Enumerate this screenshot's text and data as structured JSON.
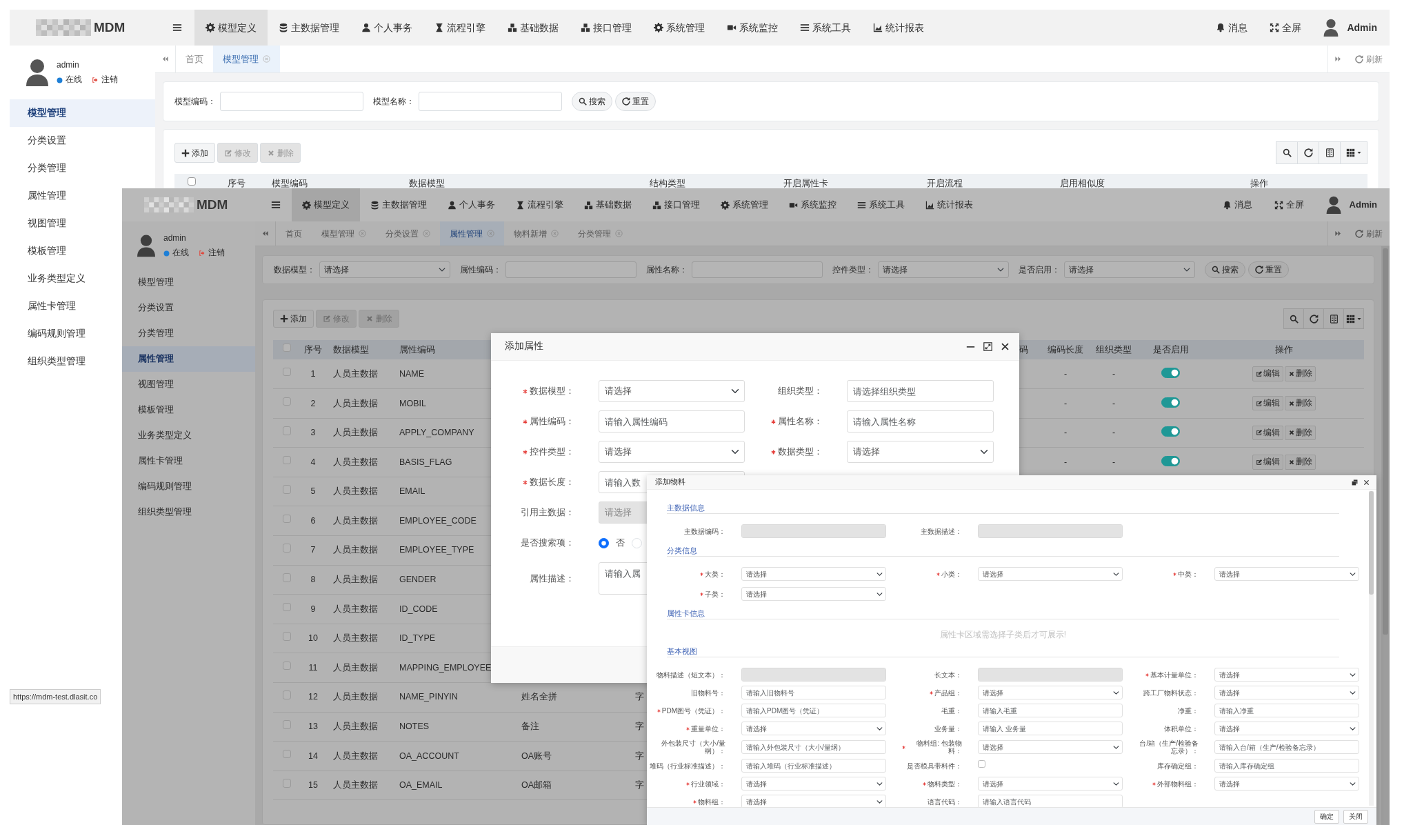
{
  "windows": [
    {
      "logo": "MDM",
      "menu": [
        {
          "label": "模型定义",
          "selected": true
        },
        {
          "label": "主数据管理",
          "selected": false
        },
        {
          "label": "个人事务",
          "selected": false
        },
        {
          "label": "流程引擎",
          "selected": false
        },
        {
          "label": "基础数据",
          "selected": false
        },
        {
          "label": "接口管理",
          "selected": false
        },
        {
          "label": "系统管理",
          "selected": false
        },
        {
          "label": "系统监控",
          "selected": false
        },
        {
          "label": "系统工具",
          "selected": false
        },
        {
          "label": "统计报表",
          "selected": false
        }
      ],
      "header_right": {
        "messages": "消息",
        "fullscreen": "全屏",
        "user": "Admin"
      },
      "sidebar": {
        "user": "admin",
        "status": "在线",
        "logout": "注销",
        "items": [
          {
            "label": "模型管理",
            "selected": true
          },
          {
            "label": "分类设置",
            "selected": false
          },
          {
            "label": "分类管理",
            "selected": false
          },
          {
            "label": "属性管理",
            "selected": false
          },
          {
            "label": "视图管理",
            "selected": false
          },
          {
            "label": "模板管理",
            "selected": false
          },
          {
            "label": "业务类型定义",
            "selected": false
          },
          {
            "label": "属性卡管理",
            "selected": false
          },
          {
            "label": "编码规则管理",
            "selected": false
          },
          {
            "label": "组织类型管理",
            "selected": false
          }
        ]
      },
      "tabs": [
        {
          "label": "首页",
          "selected": false,
          "closable": false
        },
        {
          "label": "模型管理",
          "selected": true,
          "closable": true
        }
      ],
      "refresh": "刷新",
      "search": {
        "fields": [
          {
            "kind": "input",
            "label": "模型编码："
          },
          {
            "kind": "input",
            "label": "模型名称："
          }
        ],
        "buttons": [
          "搜索",
          "重置"
        ]
      },
      "toolbar": [
        {
          "label": "添加",
          "disabled": false
        },
        {
          "label": "修改",
          "disabled": true
        },
        {
          "label": "删除",
          "disabled": true
        }
      ],
      "table": {
        "select_all_checked": false,
        "columns": [
          "序号",
          "模型编码",
          "数据模型",
          "结构类型",
          "开启属性卡",
          "开启流程",
          "启用相似度",
          "操作"
        ]
      },
      "status_url": "https://mdm-test.dlasit.co"
    },
    {
      "logo": "MDM",
      "menu": [
        {
          "label": "模型定义",
          "selected": true
        },
        {
          "label": "主数据管理",
          "selected": false
        },
        {
          "label": "个人事务",
          "selected": false
        },
        {
          "label": "流程引擎",
          "selected": false
        },
        {
          "label": "基础数据",
          "selected": false
        },
        {
          "label": "接口管理",
          "selected": false
        },
        {
          "label": "系统管理",
          "selected": false
        },
        {
          "label": "系统监控",
          "selected": false
        },
        {
          "label": "系统工具",
          "selected": false
        },
        {
          "label": "统计报表",
          "selected": false
        }
      ],
      "header_right": {
        "messages": "消息",
        "fullscreen": "全屏",
        "user": "Admin"
      },
      "sidebar": {
        "user": "admin",
        "status": "在线",
        "logout": "注销",
        "items": [
          {
            "label": "模型管理",
            "selected": false
          },
          {
            "label": "分类设置",
            "selected": false
          },
          {
            "label": "分类管理",
            "selected": false
          },
          {
            "label": "属性管理",
            "selected": true
          },
          {
            "label": "视图管理",
            "selected": false
          },
          {
            "label": "模板管理",
            "selected": false
          },
          {
            "label": "业务类型定义",
            "selected": false
          },
          {
            "label": "属性卡管理",
            "selected": false
          },
          {
            "label": "编码规则管理",
            "selected": false
          },
          {
            "label": "组织类型管理",
            "selected": false
          }
        ]
      },
      "tabs": [
        {
          "label": "首页",
          "selected": false,
          "closable": false
        },
        {
          "label": "模型管理",
          "selected": false,
          "closable": true
        },
        {
          "label": "分类设置",
          "selected": false,
          "closable": true
        },
        {
          "label": "属性管理",
          "selected": true,
          "closable": true
        },
        {
          "label": "物料新增",
          "selected": false,
          "closable": true
        },
        {
          "label": "分类管理",
          "selected": false,
          "closable": true
        }
      ],
      "refresh": "刷新",
      "search": {
        "fields": [
          {
            "kind": "select",
            "label": "数据模型：",
            "value": "请选择"
          },
          {
            "kind": "input",
            "label": "属性编码："
          },
          {
            "kind": "input",
            "label": "属性名称："
          },
          {
            "kind": "select",
            "label": "控件类型：",
            "value": "请选择"
          },
          {
            "kind": "select",
            "label": "是否启用：",
            "value": "请选择"
          }
        ],
        "buttons": [
          "搜索",
          "重置"
        ]
      },
      "toolbar": [
        {
          "label": "添加",
          "disabled": false
        },
        {
          "label": "修改",
          "disabled": true
        },
        {
          "label": "删除",
          "disabled": true
        }
      ],
      "table": {
        "select_all_checked": false,
        "columns": [
          "序号",
          "数据模型",
          "属性编码",
          "码",
          "编码长度",
          "组织类型",
          "是否启用",
          "操作"
        ],
        "rows": [
          {
            "checked": false,
            "no": "1",
            "model": "人员主数据",
            "code": "NAME",
            "code_length": "-",
            "org_type": "-",
            "enabled": true,
            "actions": [
              "编辑",
              "删除"
            ]
          },
          {
            "checked": false,
            "no": "2",
            "model": "人员主数据",
            "code": "MOBIL",
            "code_length": "-",
            "org_type": "-",
            "enabled": true,
            "actions": [
              "编辑",
              "删除"
            ]
          },
          {
            "checked": false,
            "no": "3",
            "model": "人员主数据",
            "code": "APPLY_COMPANY",
            "code_length": "-",
            "org_type": "-",
            "enabled": true,
            "actions": [
              "编辑",
              "删除"
            ]
          },
          {
            "checked": false,
            "no": "4",
            "model": "人员主数据",
            "code": "BASIS_FLAG",
            "code_length": "-",
            "org_type": "-",
            "enabled": true,
            "actions": [
              "编辑",
              "删除"
            ]
          },
          {
            "checked": false,
            "no": "5",
            "model": "人员主数据",
            "code": "EMAIL"
          },
          {
            "checked": false,
            "no": "6",
            "model": "人员主数据",
            "code": "EMPLOYEE_CODE"
          },
          {
            "checked": false,
            "no": "7",
            "model": "人员主数据",
            "code": "EMPLOYEE_TYPE"
          },
          {
            "checked": false,
            "no": "8",
            "model": "人员主数据",
            "code": "GENDER"
          },
          {
            "checked": false,
            "no": "9",
            "model": "人员主数据",
            "code": "ID_CODE"
          },
          {
            "checked": false,
            "no": "10",
            "model": "人员主数据",
            "code": "ID_TYPE"
          },
          {
            "checked": false,
            "no": "11",
            "model": "人员主数据",
            "code": "MAPPING_EMPLOYEE"
          },
          {
            "checked": false,
            "no": "12",
            "model": "人员主数据",
            "code": "NAME_PINYIN",
            "column_5": "姓名全拼",
            "column_6": "字"
          },
          {
            "checked": false,
            "no": "13",
            "model": "人员主数据",
            "code": "NOTES",
            "column_5": "备注",
            "column_6": "字"
          },
          {
            "checked": false,
            "no": "14",
            "model": "人员主数据",
            "code": "OA_ACCOUNT",
            "column_5": "OA账号",
            "column_6": "字"
          },
          {
            "checked": false,
            "no": "15",
            "model": "人员主数据",
            "code": "OA_EMAIL",
            "column_5": "OA邮箱",
            "column_6": "字"
          }
        ]
      }
    }
  ],
  "dialogs": [
    {
      "title": "添加属性",
      "rows": [
        {
          "left": {
            "kind": "select",
            "label": "数据模型：",
            "required": true,
            "disabled": false,
            "value": "请选择"
          },
          "right": {
            "kind": "input",
            "label": "组织类型：",
            "required": false,
            "disabled": false,
            "placeholder": "请选择组织类型"
          }
        },
        {
          "left": {
            "kind": "input",
            "label": "属性编码：",
            "required": true,
            "disabled": false,
            "placeholder": "请输入属性编码"
          },
          "right": {
            "kind": "input",
            "label": "属性名称：",
            "required": true,
            "disabled": false,
            "placeholder": "请输入属性名称"
          }
        },
        {
          "left": {
            "kind": "select",
            "label": "控件类型：",
            "required": true,
            "disabled": false,
            "value": "请选择"
          },
          "right": {
            "kind": "select",
            "label": "数据类型：",
            "required": true,
            "disabled": false,
            "value": "请选择"
          }
        },
        {
          "left": {
            "kind": "input",
            "label": "数据长度：",
            "required": true,
            "disabled": false,
            "placeholder": "请输入数"
          }
        },
        {
          "left": {
            "kind": "select",
            "label": "引用主数据：",
            "required": false,
            "disabled": true,
            "value": "请选择"
          }
        },
        {
          "left": {
            "kind": "radio",
            "label": "是否搜索项：",
            "required": false,
            "disabled": false,
            "options": [
              {
                "label": "否",
                "selected": true
              },
              {
                "selected": false
              }
            ]
          }
        },
        {
          "left": {
            "kind": "textarea",
            "label": "属性描述：",
            "required": false,
            "disabled": false,
            "placeholder": "请输入属"
          }
        }
      ]
    },
    {
      "title": "添加物料",
      "sections": [
        {
          "title": "主数据信息",
          "fields": [
            {
              "kind": "input",
              "label": "主数据编码：",
              "required": false,
              "disabled": true
            },
            {
              "kind": "input",
              "label": "主数据描述：",
              "required": false,
              "disabled": true
            }
          ]
        },
        {
          "title": "分类信息",
          "fields": [
            {
              "kind": "select",
              "label": "大类：",
              "required": true,
              "disabled": false,
              "value": "请选择"
            },
            {
              "kind": "select",
              "label": "小类：",
              "required": true,
              "disabled": false,
              "value": "请选择"
            },
            {
              "kind": "select",
              "label": "中类：",
              "required": true,
              "disabled": false,
              "value": "请选择"
            },
            {
              "kind": "select",
              "label": "子类：",
              "required": true,
              "disabled": false,
              "value": "请选择"
            }
          ]
        },
        {
          "title": "属性卡信息",
          "message": "属性卡区域需选择子类后才可展示!"
        },
        {
          "title": "基本视图",
          "fields": [
            {
              "kind": "input",
              "label": "物料描述（短文本）：",
              "required": false,
              "disabled": true
            },
            {
              "kind": "input",
              "label": "长文本：",
              "required": false,
              "disabled": true
            },
            {
              "kind": "select",
              "label": "基本计量单位：",
              "required": true,
              "disabled": false,
              "value": "请选择"
            },
            {
              "kind": "input",
              "label": "旧物料号：",
              "required": false,
              "disabled": false,
              "placeholder": "请输入旧物料号"
            },
            {
              "kind": "select",
              "label": "产品组：",
              "required": true,
              "disabled": false,
              "value": "请选择"
            },
            {
              "kind": "select",
              "label": "跨工厂物料状态：",
              "required": false,
              "disabled": false,
              "value": "请选择"
            },
            {
              "kind": "input",
              "label": "PDM图号（凭证）：",
              "required": true,
              "disabled": false,
              "placeholder": "请输入PDM图号（凭证）"
            },
            {
              "kind": "input",
              "label": "毛重：",
              "required": false,
              "disabled": false,
              "placeholder": "请输入毛重"
            },
            {
              "kind": "input",
              "label": "净重：",
              "required": false,
              "disabled": false,
              "placeholder": "请输入净重"
            },
            {
              "kind": "select",
              "label": "重量单位：",
              "required": true,
              "disabled": false,
              "value": "请选择"
            },
            {
              "kind": "input",
              "label": "业务量：",
              "required": false,
              "disabled": false,
              "placeholder": "请输入 业务量"
            },
            {
              "kind": "select",
              "label": "体积单位：",
              "required": false,
              "disabled": false,
              "value": "请选择"
            },
            {
              "kind": "input",
              "label": "外包装尺寸（大小/量纲）：",
              "required": false,
              "disabled": false,
              "placeholder": "请输入外包装尺寸（大小/量纲）"
            },
            {
              "kind": "select",
              "label": "物料组: 包装物料：",
              "required": true,
              "disabled": false,
              "value": "请选择"
            },
            {
              "kind": "input",
              "label": "台/箱（生产/检验备忘录）：",
              "required": false,
              "disabled": false,
              "placeholder": "请输入台/箱（生产/检验备忘录）"
            },
            {
              "kind": "input",
              "label": "堆码（行业标准描述）：",
              "required": false,
              "disabled": false,
              "placeholder": "请输入堆码（行业标准描述）"
            },
            {
              "kind": "checkbox",
              "label": "是否模具带料件：",
              "required": false,
              "disabled": false,
              "checked": false
            },
            {
              "kind": "input",
              "label": "库存确定组：",
              "required": false,
              "disabled": false,
              "placeholder": "请输入库存确定组"
            },
            {
              "kind": "select",
              "label": "行业领域：",
              "required": true,
              "disabled": false,
              "value": "请选择"
            },
            {
              "kind": "select",
              "label": "物料类型：",
              "required": true,
              "disabled": false,
              "value": "请选择"
            },
            {
              "kind": "select",
              "label": "外部物料组：",
              "required": true,
              "disabled": false,
              "value": "请选择"
            },
            {
              "kind": "select",
              "label": "物料组：",
              "required": true,
              "disabled": false,
              "value": "请选择"
            },
            {
              "kind": "input",
              "label": "语言代码：",
              "required": false,
              "disabled": false,
              "placeholder": "请输入语言代码"
            }
          ]
        }
      ],
      "buttons": [
        "确定",
        "关闭"
      ]
    }
  ]
}
